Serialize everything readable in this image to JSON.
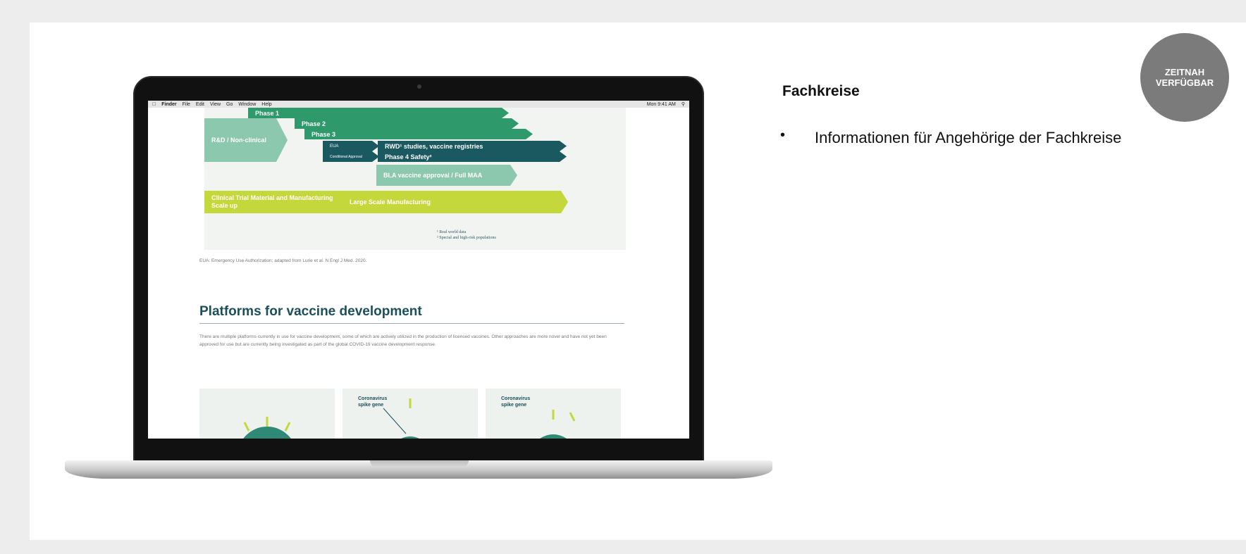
{
  "badge": {
    "line1": "ZEITNAH",
    "line2": "VERFÜGBAR"
  },
  "content": {
    "heading": "Fachkreise",
    "bullet_symbol": "•",
    "bullet_text": "Informationen für Angehörige der Fachkreise"
  },
  "laptop_screen": {
    "menubar": {
      "items": [
        "Finder",
        "File",
        "Edit",
        "View",
        "Go",
        "Window",
        "Help"
      ],
      "right": "Mon 9:41 AM"
    },
    "diagram": {
      "phase1": "Phase 1",
      "phase2": "Phase 2",
      "phase3": "Phase 3",
      "rnd": "R&D / Non-clinical",
      "eua": "EUA",
      "rwd": "RWD¹ studies, vaccine registries",
      "conditional": "Conditional Approval",
      "phase4": "Phase 4 Safety²",
      "bla": "BLA vaccine approval / Full MAA",
      "ctm": "Clinical Trial Material and Manufacturing Scale up",
      "lsm": "Large Scale Manufacturing",
      "note1": "¹ Real world data",
      "note2": "² Special and high-risk populations"
    },
    "caption": "EUA: Emergency Use Authorization; adapted from Lurie et al. N Engl J Med. 2020.",
    "section_title": "Platforms for vaccine development",
    "paragraph": "There are multiple platforms currently in use for vaccine development, some of which are actively utilized in the production of licensed vaccines. Other approaches are more novel and have not yet been approved for use but are currently being investigated as part of the global COVID-19 vaccine development response.",
    "tiles": [
      "",
      "Coronavirus spike gene",
      "Coronavirus spike gene"
    ]
  }
}
